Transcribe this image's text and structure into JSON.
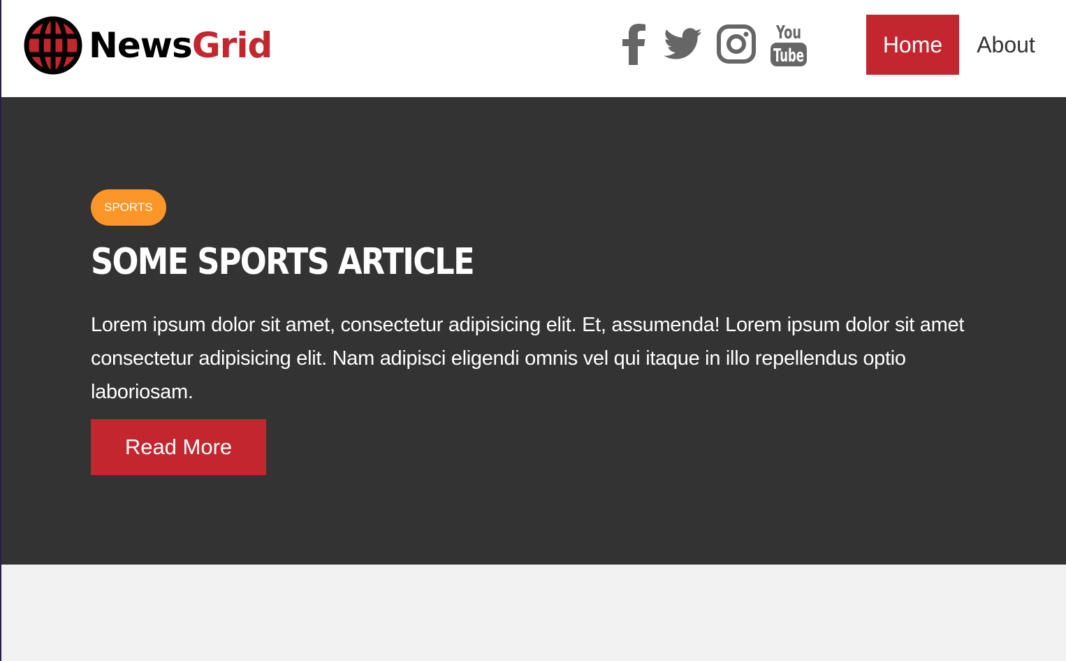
{
  "brand": {
    "name_part1": "News",
    "name_part2": "Grid",
    "accent": "#c4262e"
  },
  "social": [
    {
      "icon": "facebook-icon"
    },
    {
      "icon": "twitter-icon"
    },
    {
      "icon": "instagram-icon"
    },
    {
      "icon": "youtube-icon",
      "text_top": "You",
      "text_bottom": "Tube"
    }
  ],
  "nav": {
    "home": "Home",
    "about": "About",
    "active": "Home"
  },
  "showcase": {
    "category": "Sports",
    "category_color": "#fd9629",
    "title": "Some Sports Article",
    "excerpt": "Lorem ipsum dolor sit amet, consectetur adipisicing elit. Et, assumenda! Lorem ipsum dolor sit amet consectetur adipisicing elit. Nam adipisci eligendi omnis vel qui itaque in illo repellendus optio laboriosam.",
    "button": "Read More"
  },
  "colors": {
    "dark": "#333333",
    "light": "#f2f2f2",
    "icon_gray": "#666666"
  }
}
